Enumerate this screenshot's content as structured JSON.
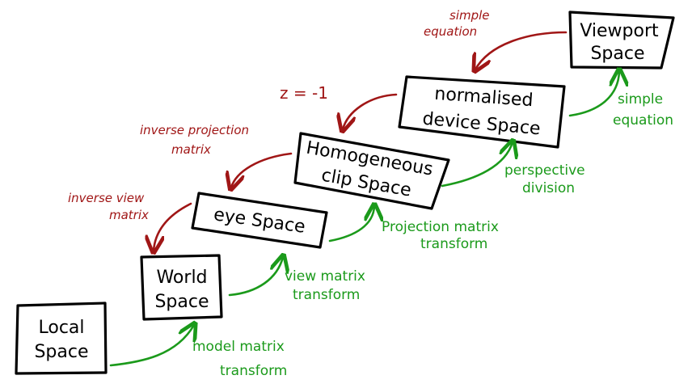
{
  "colors": {
    "forward": "#1b9a1b",
    "inverse": "#a01616",
    "box_stroke": "#000000"
  },
  "boxes": {
    "local": [
      "Local",
      "Space"
    ],
    "world": [
      "World",
      "Space"
    ],
    "eye": [
      "eye Space"
    ],
    "clip": [
      "Homogeneous",
      "clip Space"
    ],
    "ndc": [
      "normalised",
      "device Space"
    ],
    "viewport": [
      "Viewport",
      "Space"
    ]
  },
  "forward_labels": {
    "model": [
      "model matrix",
      "transform"
    ],
    "view": [
      "view matrix",
      "transform"
    ],
    "projection": [
      "Projection matrix",
      "transform"
    ],
    "perspective": [
      "perspective",
      "division"
    ],
    "viewport": [
      "simple",
      "equation"
    ]
  },
  "inverse_labels": {
    "view": [
      "inverse view",
      "matrix"
    ],
    "projection": [
      "inverse projection",
      "matrix"
    ],
    "ndc": [
      "z = -1"
    ],
    "viewport": [
      "simple",
      "equation"
    ]
  }
}
